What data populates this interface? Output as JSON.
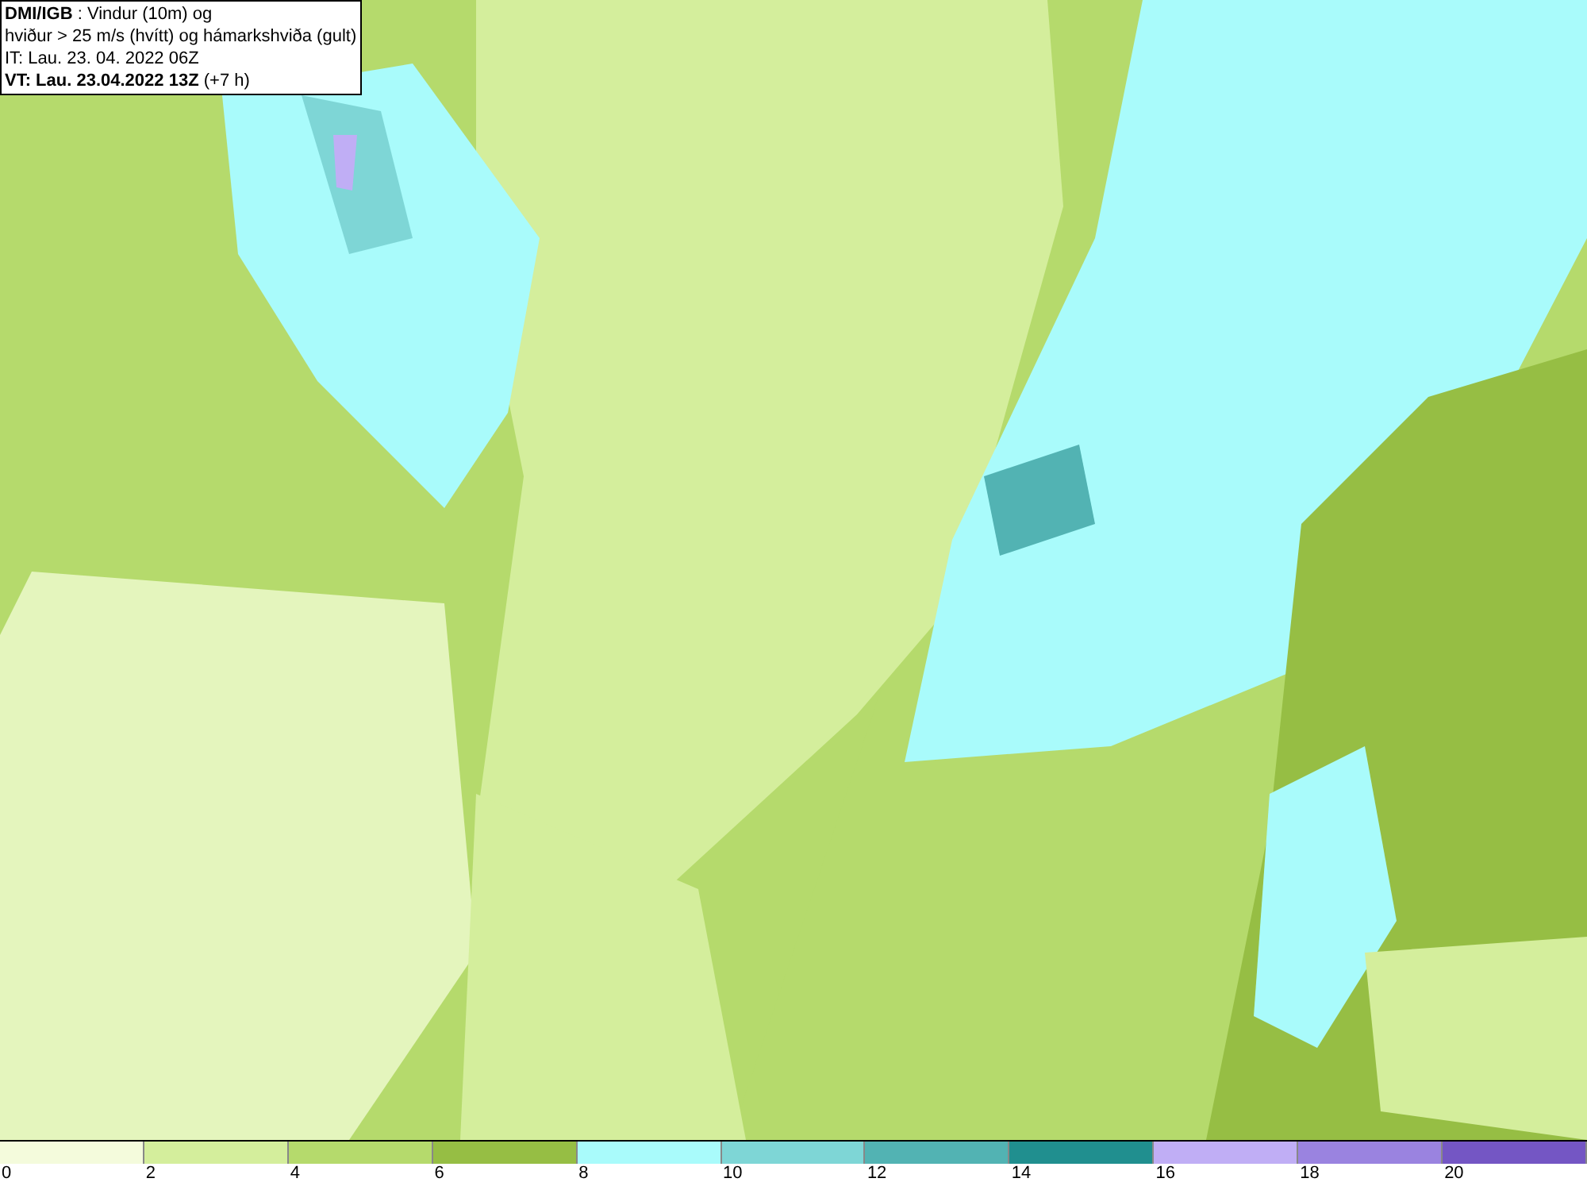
{
  "header": {
    "lines": [
      "**DMI/IGB** : Vindur (10m) og",
      "hviður > 25 m/s (hvítt) og hámarkshviða (gult)",
      "IT: Lau. 23. 04. 2022 06Z",
      "**VT: Lau. 23.04.2022 13Z** (+7 h)"
    ]
  },
  "legend": {
    "swatches": [
      {
        "color": "#f4fbdc"
      },
      {
        "color": "#d4ee9c"
      },
      {
        "color": "#b5da6c"
      },
      {
        "color": "#96be44"
      },
      {
        "color": "#a9fbfb"
      },
      {
        "color": "#7ed6d6"
      },
      {
        "color": "#52b3b3"
      },
      {
        "color": "#208f8f"
      },
      {
        "color": "#c0aef5"
      },
      {
        "color": "#9a83e0"
      },
      {
        "color": "#7456c4"
      }
    ],
    "labels": [
      "0",
      "2",
      "4",
      "6",
      "8",
      "10",
      "12",
      "14",
      "16",
      "18",
      "20"
    ]
  }
}
